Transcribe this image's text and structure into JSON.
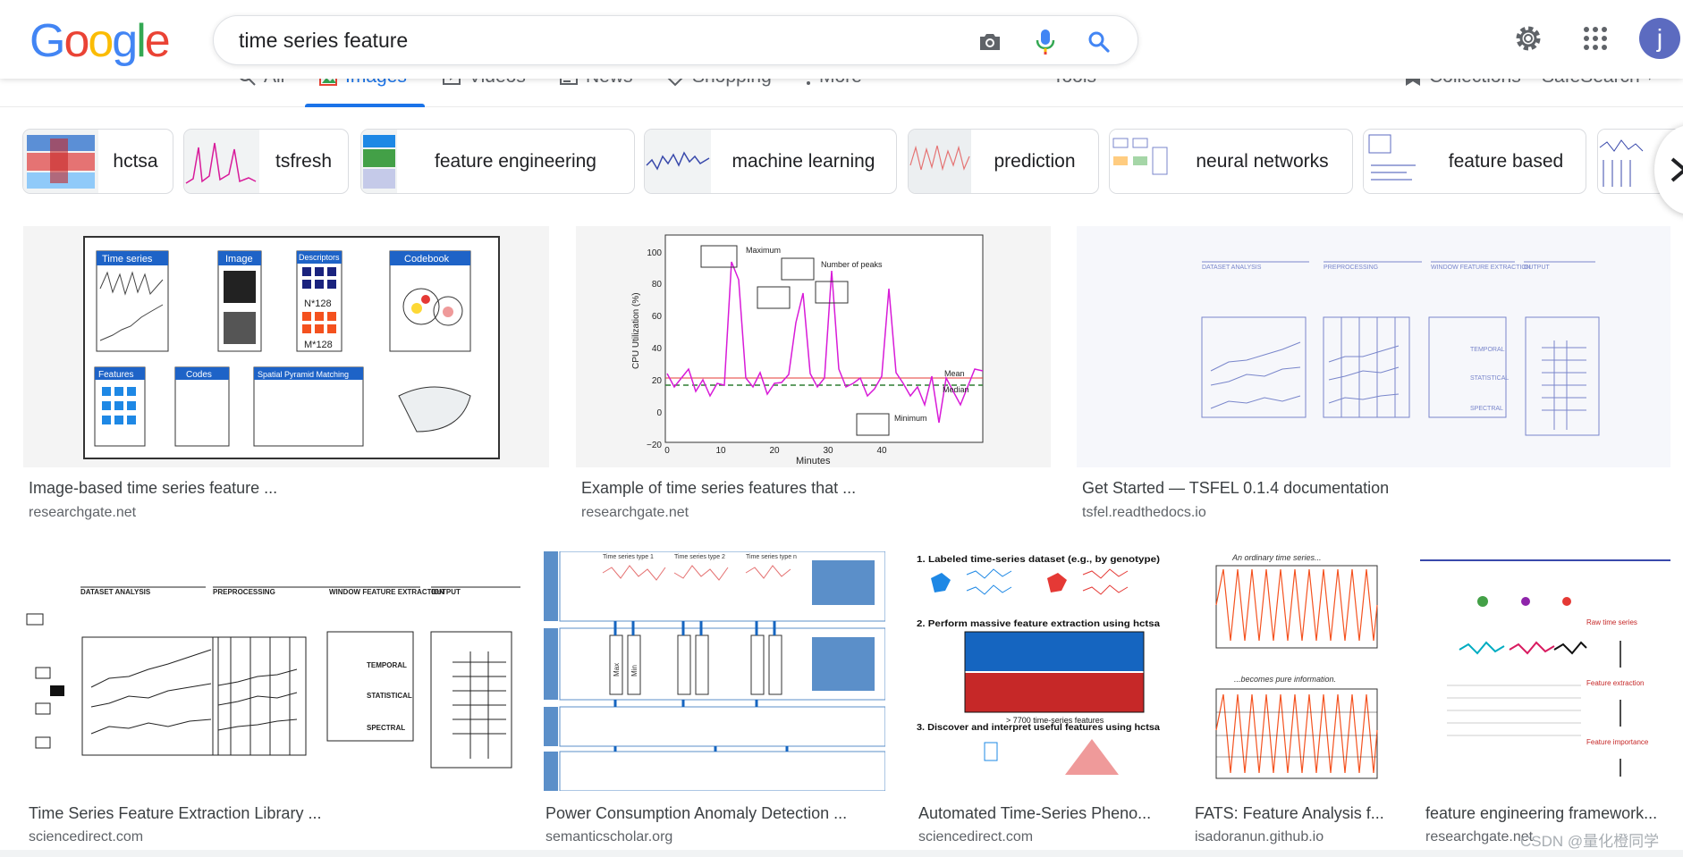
{
  "search": {
    "query": "time series feature"
  },
  "logo": {
    "letters": [
      "G",
      "o",
      "o",
      "g",
      "l",
      "e"
    ],
    "colors": [
      "#4285F4",
      "#EA4335",
      "#FBBC05",
      "#4285F4",
      "#34A853",
      "#EA4335"
    ]
  },
  "account": {
    "initial": "j"
  },
  "tabs": [
    {
      "label": "All"
    },
    {
      "label": "Images"
    },
    {
      "label": "Videos"
    },
    {
      "label": "News"
    },
    {
      "label": "Shopping"
    },
    {
      "label": "More"
    }
  ],
  "tools": {
    "tools_label": "Tools",
    "collections_label": "Collections",
    "safesearch_label": "SafeSearch"
  },
  "chips": [
    {
      "label": "hctsa"
    },
    {
      "label": "tsfresh"
    },
    {
      "label": "feature engineering"
    },
    {
      "label": "machine learning"
    },
    {
      "label": "prediction"
    },
    {
      "label": "neural networks"
    },
    {
      "label": "feature based"
    }
  ],
  "results": [
    {
      "title": "Image-based time series feature ...",
      "source": "researchgate.net"
    },
    {
      "title": "Example of time series features that ...",
      "source": "researchgate.net"
    },
    {
      "title": "Get Started — TSFEL 0.1.4 documentation",
      "source": "tsfel.readthedocs.io"
    },
    {
      "title": "Time Series Feature Extraction Library ...",
      "source": "sciencedirect.com"
    },
    {
      "title": "Power Consumption Anomaly Detection ...",
      "source": "semanticscholar.org"
    },
    {
      "title": "Automated Time-Series Pheno...",
      "source": "sciencedirect.com"
    },
    {
      "title": "FATS: Feature Analysis f...",
      "source": "isadoranun.github.io"
    },
    {
      "title": "feature engineering framework...",
      "source": "researchgate.net"
    }
  ],
  "thumbnail_text": {
    "r0": {
      "time_series": "Time series",
      "image": "Image",
      "descriptors": "Descriptors",
      "codebook": "Codebook",
      "features": "Features",
      "codes": "Codes",
      "spm": "Spatial Pyramid Matching",
      "n128": "N*128",
      "m128": "M*128"
    },
    "r1": {
      "maximum": "Maximum",
      "peaks": "Number of peaks",
      "minimum": "Minimum",
      "mean": "Mean",
      "median": "Median",
      "xlabel": "Minutes",
      "ylabel": "CPU Utilization (%)",
      "yticks": [
        "100",
        "80",
        "60",
        "40",
        "20",
        "0",
        "−20"
      ],
      "xticks": [
        "0",
        "10",
        "20",
        "30",
        "40"
      ]
    },
    "r2": {
      "h1": "DATASET ANALYSIS",
      "h2": "PREPROCESSING",
      "h3": "WINDOW FEATURE EXTRACTION",
      "h4": "OUTPUT",
      "t": "TEMPORAL",
      "s": "STATISTICAL",
      "sp": "SPECTRAL"
    },
    "r3": {
      "h1": "DATASET ANALYSIS",
      "h2": "PREPROCESSING",
      "h3": "WINDOW FEATURE EXTRACTION",
      "h4": "OUTPUT",
      "t": "TEMPORAL",
      "s": "STATISTICAL",
      "sp": "SPECTRAL"
    },
    "r4": {
      "a": "Time series type 1",
      "b": "Time series type 2",
      "c": "Time series type n",
      "max": "Max",
      "min": "Min"
    },
    "r5": {
      "s1": "1. Labeled time-series dataset (e.g., by genotype)",
      "s2": "2. Perform massive feature extraction using hctsa",
      "s3": "3. Discover and interpret useful features using hctsa",
      "n": "> 7700 time-series features"
    },
    "r6": {
      "a": "An ordinary time series...",
      "b": "...becomes pure information."
    },
    "r7": {
      "a": "Raw time series",
      "b": "Feature extraction",
      "c": "Feature importance"
    }
  },
  "watermark": "CSDN @量化橙同学"
}
